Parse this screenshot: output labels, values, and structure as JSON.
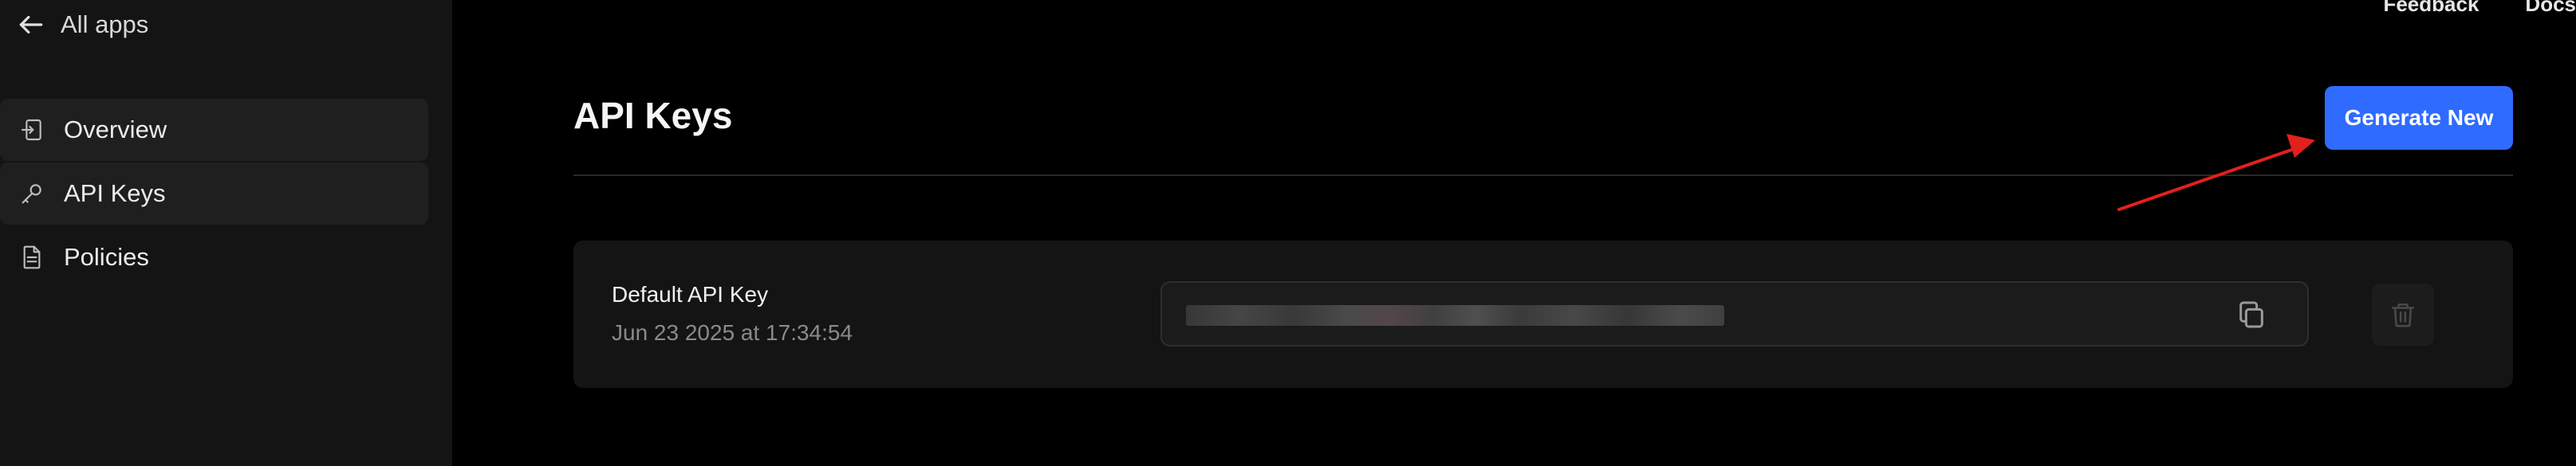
{
  "sidebar": {
    "back_label": "All apps",
    "items": [
      {
        "label": "Overview",
        "icon": "sign-in-icon",
        "active": true
      },
      {
        "label": "API Keys",
        "icon": "key-icon",
        "active": true
      },
      {
        "label": "Policies",
        "icon": "document-icon",
        "active": false
      }
    ]
  },
  "header": {
    "links": [
      "Feedback",
      "Docs"
    ]
  },
  "main": {
    "title": "API Keys",
    "generate_label": "Generate New",
    "accent_color": "#2f6bff",
    "annotation_color": "#e3201b"
  },
  "keys": [
    {
      "name": "Default API Key",
      "created": "Jun 23 2025 at 17:34:54",
      "value_masked": true
    }
  ]
}
